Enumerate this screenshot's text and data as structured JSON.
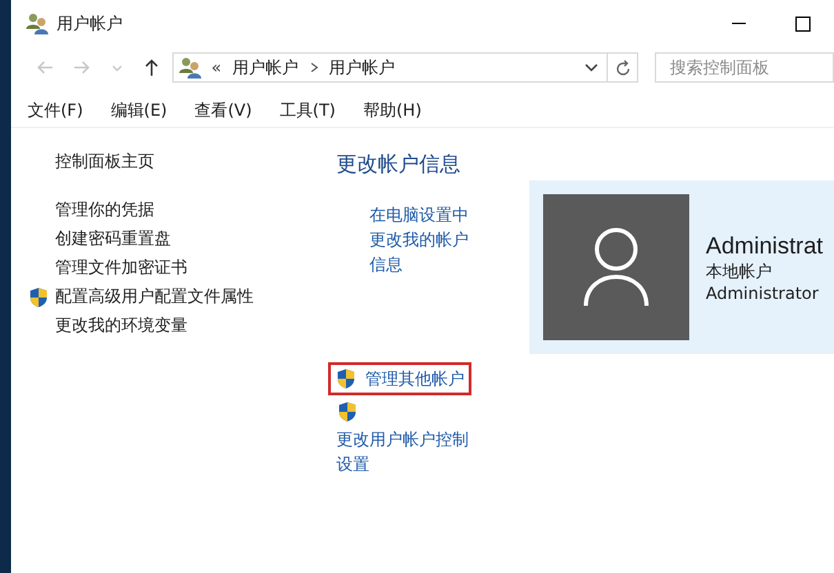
{
  "window": {
    "title": "用户帐户"
  },
  "address_bar": {
    "overflow": "«",
    "path": [
      "用户帐户",
      "用户帐户"
    ]
  },
  "search": {
    "placeholder": "搜索控制面板"
  },
  "menu": [
    "文件(F)",
    "编辑(E)",
    "查看(V)",
    "工具(T)",
    "帮助(H)"
  ],
  "sidebar": {
    "items": [
      {
        "label": "控制面板主页",
        "kind": "home"
      },
      {
        "label": "管理你的凭据",
        "kind": "plain"
      },
      {
        "label": "创建密码重置盘",
        "kind": "plain"
      },
      {
        "label": "管理文件加密证书",
        "kind": "plain"
      },
      {
        "label": "配置高级用户配置文件属性",
        "kind": "shield"
      },
      {
        "label": "更改我的环境变量",
        "kind": "plain"
      }
    ]
  },
  "main": {
    "heading": "更改帐户信息",
    "links": [
      {
        "label": "在电脑设置中更改我的帐户信息",
        "kind": "plain",
        "highlighted": false
      },
      {
        "label": "管理其他帐户",
        "kind": "shield-inline",
        "highlighted": true
      },
      {
        "label": "更改用户帐户控制设置",
        "kind": "shield-above",
        "highlighted": false
      }
    ]
  },
  "account": {
    "name": "Administrat",
    "type": "本地帐户",
    "role": "Administrator"
  }
}
